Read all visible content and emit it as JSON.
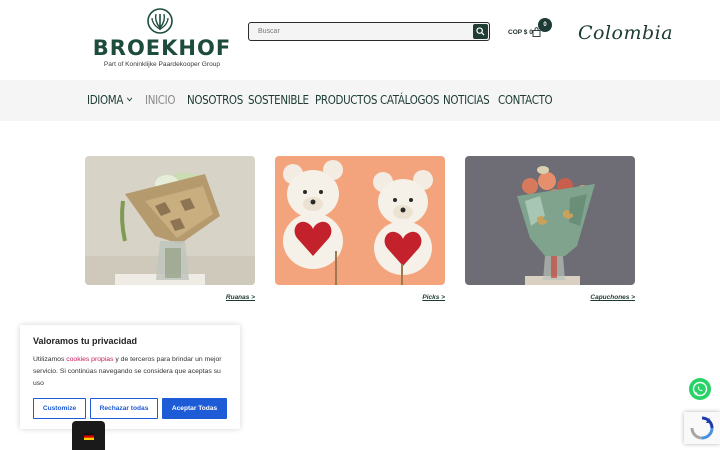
{
  "header": {
    "logo": {
      "wordmark": "BROEKHOF",
      "tagline": "Part of Koninklijke Paardekooper Group"
    },
    "search": {
      "placeholder": "Buscar"
    },
    "cart": {
      "total": "COP $ 0",
      "count": "0"
    },
    "country": "Colombia"
  },
  "nav": {
    "items": [
      {
        "label": "IDIOMA",
        "has_dropdown": true
      },
      {
        "label": "INICIO",
        "active": true
      },
      {
        "label": "NOSOTROS"
      },
      {
        "label": "SOSTENIBLE"
      },
      {
        "label": "PRODUCTOS"
      },
      {
        "label": "CATÁLOGOS"
      },
      {
        "label": "NOTICIAS"
      },
      {
        "label": "CONTACTO"
      }
    ]
  },
  "products": [
    {
      "link": "Ruanas >",
      "image": "bouquet-in-kraft-wrap"
    },
    {
      "link": "Picks >",
      "image": "teddy-bears-with-hearts"
    },
    {
      "link": "Capuchones >",
      "image": "bouquet-in-green-sleeve"
    }
  ],
  "cookie_banner": {
    "title": "Valoramos tu privacidad",
    "text_before": "Utilizamos ",
    "link_text": "cookies propias",
    "text_after": " y de terceros para brindar un mejor servicio. Si continúas navegando se considera que aceptas su uso",
    "customize": "Customize",
    "reject": "Rechazar todas",
    "accept": "Aceptar Todas"
  },
  "widgets": {
    "language_flag": "germany-flag-icon",
    "chat": "whatsapp-icon",
    "captcha": "recaptcha-icon"
  },
  "colors": {
    "brand_green": "#1d3b34",
    "accent_blue": "#1e5bd6",
    "nav_bg": "#f5f5f5",
    "whatsapp": "#25d366"
  }
}
